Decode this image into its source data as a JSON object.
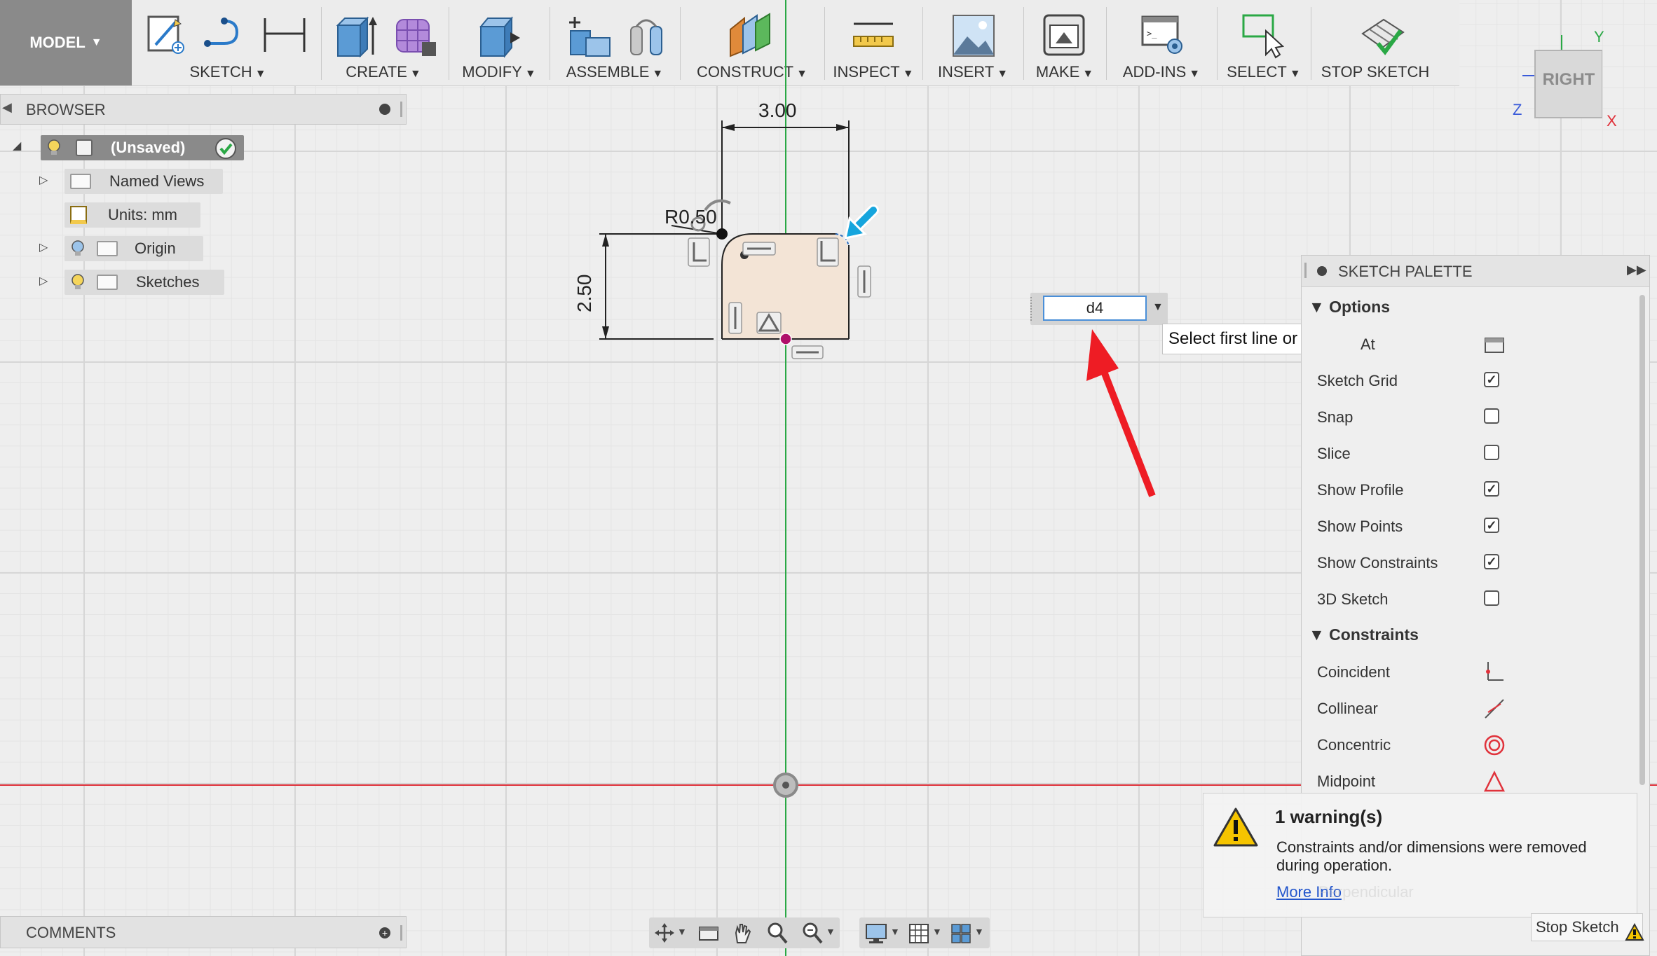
{
  "toolbar": {
    "model": "MODEL",
    "groups": [
      {
        "label": "SKETCH"
      },
      {
        "label": "CREATE"
      },
      {
        "label": "MODIFY"
      },
      {
        "label": "ASSEMBLE"
      },
      {
        "label": "CONSTRUCT"
      },
      {
        "label": "INSPECT"
      },
      {
        "label": "INSERT"
      },
      {
        "label": "MAKE"
      },
      {
        "label": "ADD-INS"
      },
      {
        "label": "SELECT"
      },
      {
        "label": "STOP SKETCH"
      }
    ],
    "caret": "▼"
  },
  "browser": {
    "title": "BROWSER",
    "root": "(Unsaved)",
    "items": [
      {
        "label": "Named Views"
      },
      {
        "label": "Units: mm"
      },
      {
        "label": "Origin"
      },
      {
        "label": "Sketches"
      }
    ]
  },
  "comments": {
    "title": "COMMENTS"
  },
  "viewcube": {
    "face": "RIGHT",
    "axis_x": "X",
    "axis_y": "Y",
    "axis_z": "Z"
  },
  "sketch": {
    "dim_width": "3.00",
    "dim_height": "2.50",
    "dim_radius": "R0.50",
    "input_value": "d4",
    "tooltip": "Select first line or arc"
  },
  "palette": {
    "title": "SKETCH PALETTE",
    "options_title": "Options",
    "options": [
      {
        "label": "At",
        "kind": "icon"
      },
      {
        "label": "Sketch Grid",
        "checked": true
      },
      {
        "label": "Snap",
        "checked": false
      },
      {
        "label": "Slice",
        "checked": false
      },
      {
        "label": "Show Profile",
        "checked": true
      },
      {
        "label": "Show Points",
        "checked": true
      },
      {
        "label": "Show Constraints",
        "checked": true
      },
      {
        "label": "3D Sketch",
        "checked": false
      }
    ],
    "constraints_title": "Constraints",
    "constraints": [
      {
        "label": "Coincident"
      },
      {
        "label": "Collinear"
      },
      {
        "label": "Concentric"
      },
      {
        "label": "Midpoint"
      }
    ],
    "check_mark": "✓"
  },
  "warning": {
    "title": "1 warning(s)",
    "message_line1": "Constraints and/or dimensions were removed",
    "message_line2": "during operation.",
    "link": "More Info",
    "hidden_behind": "Perpendicular"
  },
  "stop_sketch_button": "Stop Sketch",
  "colors": {
    "x_axis": "#e0323b",
    "y_axis": "#2aa845",
    "profile_fill": "#f3e4d6",
    "accent_blue": "#2f6fbf",
    "red_arrow": "#ee1c24",
    "cyan_arrow": "#16a5dd"
  }
}
